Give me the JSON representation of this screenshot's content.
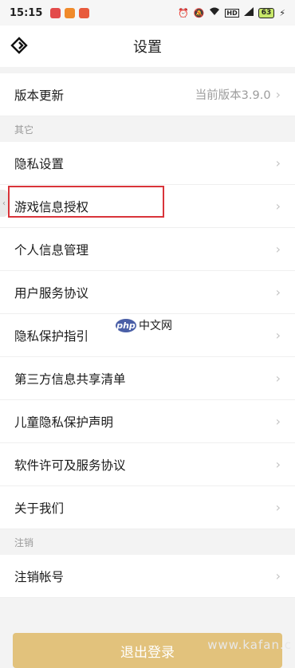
{
  "status_bar": {
    "time": "15:15",
    "battery": "63"
  },
  "header": {
    "title": "设置"
  },
  "version_row": {
    "label": "版本更新",
    "value": "当前版本3.9.0"
  },
  "sections": [
    {
      "label": "其它",
      "items": [
        "隐私设置",
        "游戏信息授权",
        "个人信息管理",
        "用户服务协议",
        "隐私保护指引",
        "第三方信息共享清单",
        "儿童隐私保护声明",
        "软件许可及服务协议",
        "关于我们"
      ]
    },
    {
      "label": "注销",
      "items": [
        "注销帐号"
      ]
    }
  ],
  "watermark": {
    "logo": "php",
    "text": "中文网"
  },
  "logout_button": "退出登录",
  "kafan_watermark": "www.kafan.c",
  "colors": {
    "highlight": "#d9343a",
    "logout": "#e2c27c"
  }
}
